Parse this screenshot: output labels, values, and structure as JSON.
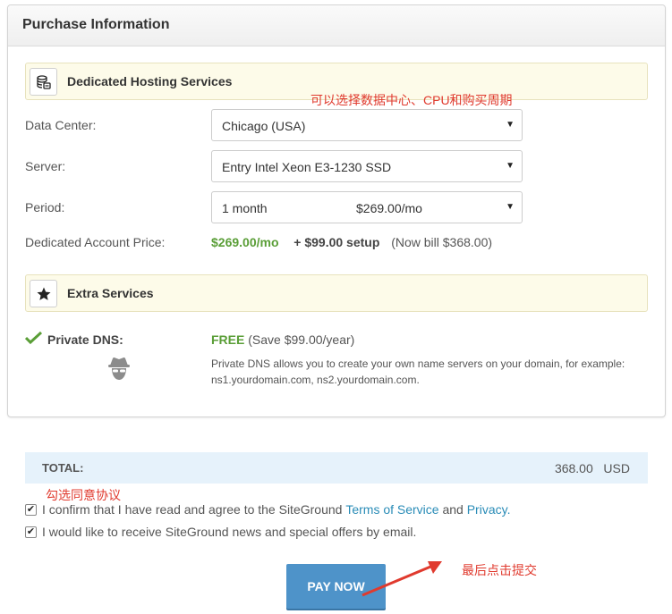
{
  "panel": {
    "title": "Purchase Information"
  },
  "hosting": {
    "section_title": "Dedicated Hosting Services",
    "icon": "server-stack-icon",
    "data_center_label": "Data Center:",
    "data_center_value": "Chicago (USA)",
    "server_label": "Server:",
    "server_value": "Entry Intel Xeon E3-1230 SSD",
    "period_label": "Period:",
    "period_value": "1 month",
    "period_price": "$269.00/mo",
    "price_label": "Dedicated Account Price:",
    "price_monthly": "$269.00/mo",
    "price_setup": "+ $99.00 setup",
    "price_bill": "(Now bill $368.00)"
  },
  "extra": {
    "section_title": "Extra Services",
    "icon": "star-icon",
    "dns_label": "Private DNS:",
    "dns_free": "FREE",
    "dns_save": "(Save $99.00/year)",
    "dns_desc_line1": "Private DNS allows you to create your own name servers on your domain, for example:",
    "dns_desc_line2": "ns1.yourdomain.com, ns2.yourdomain.com."
  },
  "total": {
    "label": "TOTAL:",
    "value": "368.00   USD"
  },
  "agree": {
    "tos_prefix": "I confirm that I have read and agree to the SiteGround",
    "tos_link": "Terms of Service",
    "and": "and",
    "privacy_link": "Privacy.",
    "news": "I would like to receive SiteGround news and special offers by email."
  },
  "pay_button": "PAY NOW",
  "annotations": {
    "choose_options": "可以选择数据中心、CPU和购买周期",
    "check_agreement": "勾选同意协议",
    "click_submit": "最后点击提交"
  },
  "colors": {
    "accent_green": "#5a9e37",
    "link_blue": "#2a8cb7",
    "button_blue": "#4e93c9",
    "annotation_red": "#e03a2e"
  }
}
